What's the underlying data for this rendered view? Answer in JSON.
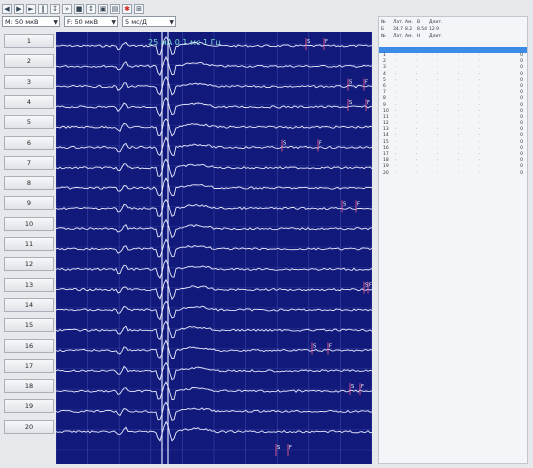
{
  "toolbar": {
    "icons": [
      "back-icon",
      "forward-icon",
      "play-icon",
      "pause-icon",
      "step-icon",
      "skip-icon",
      "stop-icon",
      "mark-icon",
      "save-icon",
      "print-icon",
      "record-icon",
      "grid-icon"
    ]
  },
  "selects": {
    "amplitude": "М: 50 мкВ",
    "filter": "F: 50 мкВ",
    "speed": "5 мс/Д"
  },
  "trace": {
    "stim_label": "25 мА 0.1 мс 1 Гц"
  },
  "channels": [
    "1",
    "2",
    "3",
    "4",
    "5",
    "6",
    "7",
    "8",
    "9",
    "10",
    "11",
    "12",
    "13",
    "14",
    "15",
    "16",
    "17",
    "18",
    "19",
    "20"
  ],
  "markers": {
    "s": "S",
    "f": "F"
  },
  "table": {
    "headers": [
      [
        "№",
        "Лат.",
        "Ам.",
        "В",
        "Длит."
      ],
      [
        "Б",
        "34.7",
        "8.2",
        "8.54",
        "12.9"
      ],
      [
        "№",
        "Лат.",
        "Ам.",
        "Н",
        "Длит."
      ]
    ],
    "row_numbers": [
      "1",
      "2",
      "3",
      "4",
      "5",
      "6",
      "7",
      "8",
      "9",
      "10",
      "11",
      "12",
      "13",
      "14",
      "15",
      "16",
      "17",
      "18",
      "19",
      "20"
    ],
    "zero_value": "0"
  }
}
